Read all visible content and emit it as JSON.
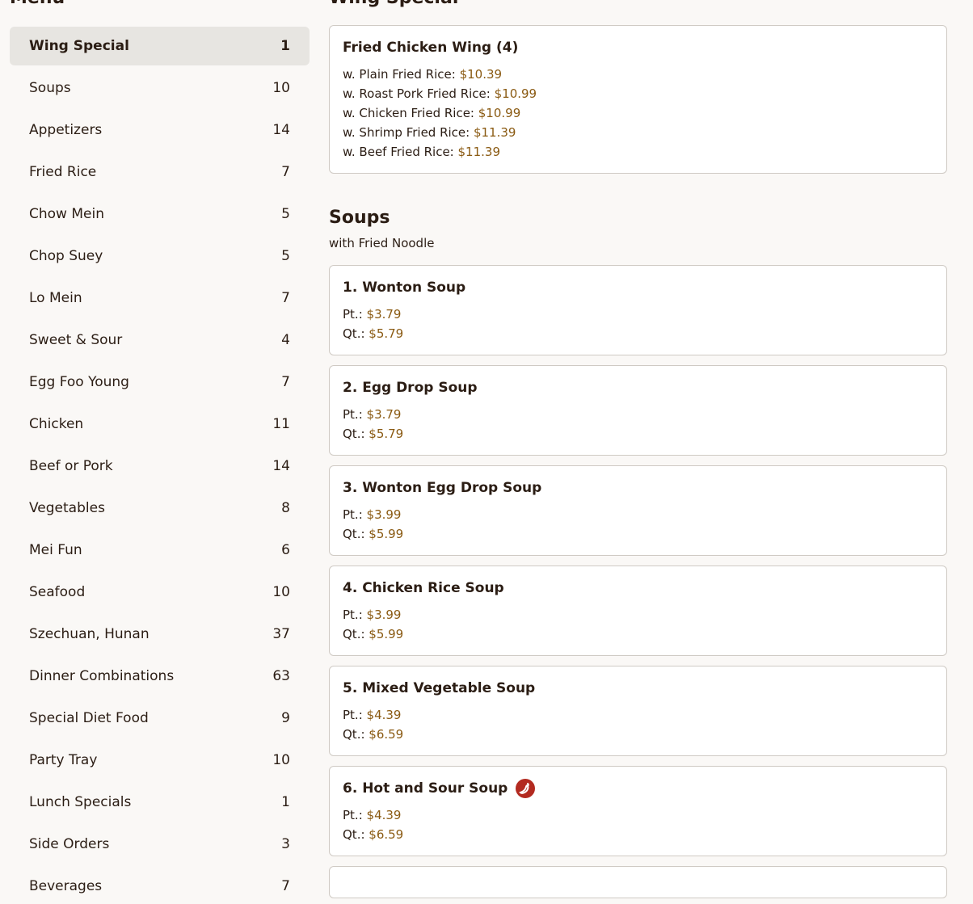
{
  "sidebar": {
    "title": "Menu",
    "items": [
      {
        "label": "Wing Special",
        "count": "1"
      },
      {
        "label": "Soups",
        "count": "10"
      },
      {
        "label": "Appetizers",
        "count": "14"
      },
      {
        "label": "Fried Rice",
        "count": "7"
      },
      {
        "label": "Chow Mein",
        "count": "5"
      },
      {
        "label": "Chop Suey",
        "count": "5"
      },
      {
        "label": "Lo Mein",
        "count": "7"
      },
      {
        "label": "Sweet & Sour",
        "count": "4"
      },
      {
        "label": "Egg Foo Young",
        "count": "7"
      },
      {
        "label": "Chicken",
        "count": "11"
      },
      {
        "label": "Beef or Pork",
        "count": "14"
      },
      {
        "label": "Vegetables",
        "count": "8"
      },
      {
        "label": "Mei Fun",
        "count": "6"
      },
      {
        "label": "Seafood",
        "count": "10"
      },
      {
        "label": "Szechuan, Hunan",
        "count": "37"
      },
      {
        "label": "Dinner Combinations",
        "count": "63"
      },
      {
        "label": "Special Diet Food",
        "count": "9"
      },
      {
        "label": "Party Tray",
        "count": "10"
      },
      {
        "label": "Lunch Specials",
        "count": "1"
      },
      {
        "label": "Side Orders",
        "count": "3"
      },
      {
        "label": "Beverages",
        "count": "7"
      }
    ]
  },
  "wing": {
    "title": "Wing Special",
    "item": {
      "name": "Fried Chicken Wing (4)",
      "lines": [
        {
          "label": "w. Plain Fried Rice: ",
          "price": "$10.39"
        },
        {
          "label": "w. Roast Pork Fried Rice: ",
          "price": "$10.99"
        },
        {
          "label": "w. Chicken Fried Rice: ",
          "price": "$10.99"
        },
        {
          "label": "w. Shrimp Fried Rice: ",
          "price": "$11.39"
        },
        {
          "label": "w. Beef Fried Rice: ",
          "price": "$11.39"
        }
      ]
    }
  },
  "soups": {
    "title": "Soups",
    "subtitle": "with Fried Noodle",
    "items": [
      {
        "name": "1. Wonton Soup",
        "pt_label": "Pt.: ",
        "pt": "$3.79",
        "qt_label": "Qt.: ",
        "qt": "$5.79"
      },
      {
        "name": "2. Egg Drop Soup",
        "pt_label": "Pt.: ",
        "pt": "$3.79",
        "qt_label": "Qt.: ",
        "qt": "$5.79"
      },
      {
        "name": "3. Wonton Egg Drop Soup",
        "pt_label": "Pt.: ",
        "pt": "$3.99",
        "qt_label": "Qt.: ",
        "qt": "$5.99"
      },
      {
        "name": "4. Chicken Rice Soup",
        "pt_label": "Pt.: ",
        "pt": "$3.99",
        "qt_label": "Qt.: ",
        "qt": "$5.99"
      },
      {
        "name": "5. Mixed Vegetable Soup",
        "pt_label": "Pt.: ",
        "pt": "$4.39",
        "qt_label": "Qt.: ",
        "qt": "$6.59"
      },
      {
        "name": "6. Hot and Sour Soup",
        "pt_label": "Pt.: ",
        "pt": "$4.39",
        "qt_label": "Qt.: ",
        "qt": "$6.59",
        "icon": "spicy-icon"
      }
    ]
  },
  "colors": {
    "price": "#8a5a12",
    "active_bg": "#e7e5e1",
    "spicy": "#b32a20"
  }
}
